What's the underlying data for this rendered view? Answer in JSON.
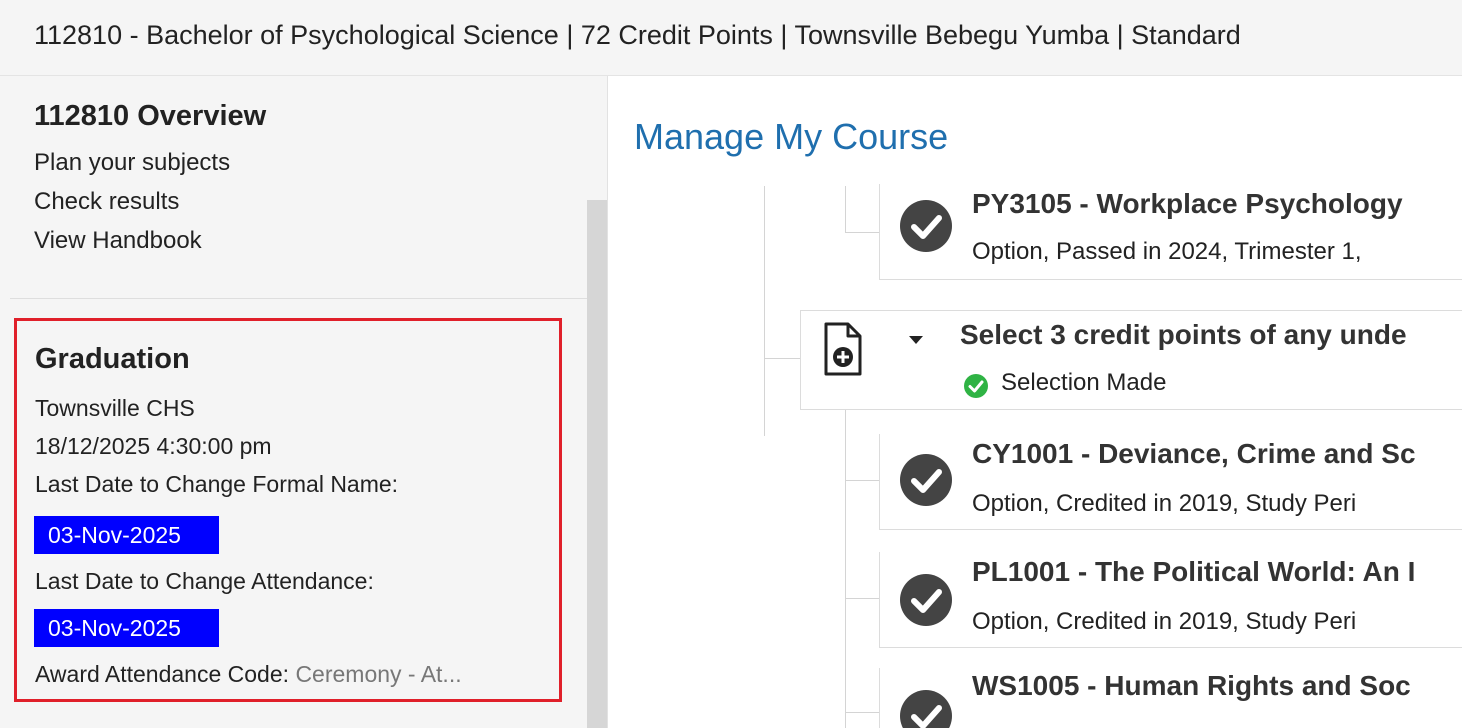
{
  "header": {
    "course_line": "112810 - Bachelor of Psychological Science | 72 Credit Points | Townsville Bebegu Yumba | Standard"
  },
  "sidebar": {
    "overview_title": "112810 Overview",
    "links": [
      "Plan your subjects",
      "Check results",
      "View Handbook"
    ],
    "graduation": {
      "title": "Graduation",
      "location": "Townsville CHS",
      "datetime": "18/12/2025 4:30:00 pm",
      "formal_name_label": "Last Date to Change Formal Name:",
      "formal_name_date": "03-Nov-2025",
      "attendance_label": "Last Date to Change Attendance:",
      "attendance_date": "03-Nov-2025",
      "award_code_label": "Award Attendance Code:",
      "award_code_value": "Ceremony - At..."
    }
  },
  "main": {
    "title": "Manage My Course",
    "subjects": [
      {
        "title": "PY3105 - Workplace Psychology",
        "status": "Option, Passed in 2024, Trimester 1,"
      },
      {
        "title": "CY1001 - Deviance, Crime and Sc",
        "status": "Option, Credited in 2019, Study Peri"
      },
      {
        "title": "PL1001 - The Political World: An I",
        "status": "Option, Credited in 2019, Study Peri"
      },
      {
        "title": "WS1005 - Human Rights and Soc",
        "status": ""
      }
    ],
    "selection_group": {
      "title": "Select 3 credit points of any unde",
      "status": "Selection Made"
    }
  },
  "icons": {
    "subject_status": "check-circle-icon",
    "selection_doc": "document-add-icon",
    "expand": "caret-down-icon",
    "selection_status": "green-check-icon"
  },
  "colors": {
    "accent_title": "#1f6fae",
    "highlight_box_border": "#e0202a",
    "date_badge": "#0000ff",
    "success_green": "#2fb344"
  }
}
